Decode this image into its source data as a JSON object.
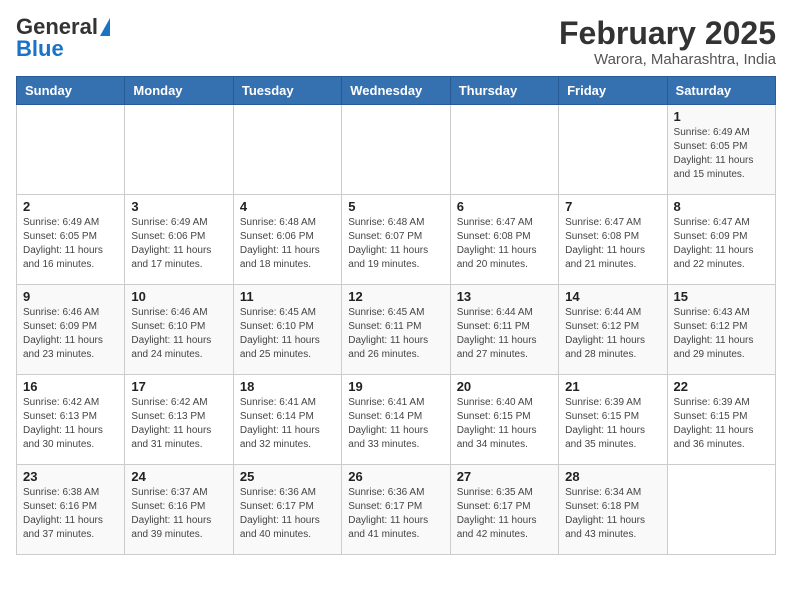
{
  "header": {
    "logo_general": "General",
    "logo_blue": "Blue",
    "month": "February 2025",
    "location": "Warora, Maharashtra, India"
  },
  "weekdays": [
    "Sunday",
    "Monday",
    "Tuesday",
    "Wednesday",
    "Thursday",
    "Friday",
    "Saturday"
  ],
  "weeks": [
    [
      {
        "day": "",
        "info": ""
      },
      {
        "day": "",
        "info": ""
      },
      {
        "day": "",
        "info": ""
      },
      {
        "day": "",
        "info": ""
      },
      {
        "day": "",
        "info": ""
      },
      {
        "day": "",
        "info": ""
      },
      {
        "day": "1",
        "info": "Sunrise: 6:49 AM\nSunset: 6:05 PM\nDaylight: 11 hours\nand 15 minutes."
      }
    ],
    [
      {
        "day": "2",
        "info": "Sunrise: 6:49 AM\nSunset: 6:05 PM\nDaylight: 11 hours\nand 16 minutes."
      },
      {
        "day": "3",
        "info": "Sunrise: 6:49 AM\nSunset: 6:06 PM\nDaylight: 11 hours\nand 17 minutes."
      },
      {
        "day": "4",
        "info": "Sunrise: 6:48 AM\nSunset: 6:06 PM\nDaylight: 11 hours\nand 18 minutes."
      },
      {
        "day": "5",
        "info": "Sunrise: 6:48 AM\nSunset: 6:07 PM\nDaylight: 11 hours\nand 19 minutes."
      },
      {
        "day": "6",
        "info": "Sunrise: 6:47 AM\nSunset: 6:08 PM\nDaylight: 11 hours\nand 20 minutes."
      },
      {
        "day": "7",
        "info": "Sunrise: 6:47 AM\nSunset: 6:08 PM\nDaylight: 11 hours\nand 21 minutes."
      },
      {
        "day": "8",
        "info": "Sunrise: 6:47 AM\nSunset: 6:09 PM\nDaylight: 11 hours\nand 22 minutes."
      }
    ],
    [
      {
        "day": "9",
        "info": "Sunrise: 6:46 AM\nSunset: 6:09 PM\nDaylight: 11 hours\nand 23 minutes."
      },
      {
        "day": "10",
        "info": "Sunrise: 6:46 AM\nSunset: 6:10 PM\nDaylight: 11 hours\nand 24 minutes."
      },
      {
        "day": "11",
        "info": "Sunrise: 6:45 AM\nSunset: 6:10 PM\nDaylight: 11 hours\nand 25 minutes."
      },
      {
        "day": "12",
        "info": "Sunrise: 6:45 AM\nSunset: 6:11 PM\nDaylight: 11 hours\nand 26 minutes."
      },
      {
        "day": "13",
        "info": "Sunrise: 6:44 AM\nSunset: 6:11 PM\nDaylight: 11 hours\nand 27 minutes."
      },
      {
        "day": "14",
        "info": "Sunrise: 6:44 AM\nSunset: 6:12 PM\nDaylight: 11 hours\nand 28 minutes."
      },
      {
        "day": "15",
        "info": "Sunrise: 6:43 AM\nSunset: 6:12 PM\nDaylight: 11 hours\nand 29 minutes."
      }
    ],
    [
      {
        "day": "16",
        "info": "Sunrise: 6:42 AM\nSunset: 6:13 PM\nDaylight: 11 hours\nand 30 minutes."
      },
      {
        "day": "17",
        "info": "Sunrise: 6:42 AM\nSunset: 6:13 PM\nDaylight: 11 hours\nand 31 minutes."
      },
      {
        "day": "18",
        "info": "Sunrise: 6:41 AM\nSunset: 6:14 PM\nDaylight: 11 hours\nand 32 minutes."
      },
      {
        "day": "19",
        "info": "Sunrise: 6:41 AM\nSunset: 6:14 PM\nDaylight: 11 hours\nand 33 minutes."
      },
      {
        "day": "20",
        "info": "Sunrise: 6:40 AM\nSunset: 6:15 PM\nDaylight: 11 hours\nand 34 minutes."
      },
      {
        "day": "21",
        "info": "Sunrise: 6:39 AM\nSunset: 6:15 PM\nDaylight: 11 hours\nand 35 minutes."
      },
      {
        "day": "22",
        "info": "Sunrise: 6:39 AM\nSunset: 6:15 PM\nDaylight: 11 hours\nand 36 minutes."
      }
    ],
    [
      {
        "day": "23",
        "info": "Sunrise: 6:38 AM\nSunset: 6:16 PM\nDaylight: 11 hours\nand 37 minutes."
      },
      {
        "day": "24",
        "info": "Sunrise: 6:37 AM\nSunset: 6:16 PM\nDaylight: 11 hours\nand 39 minutes."
      },
      {
        "day": "25",
        "info": "Sunrise: 6:36 AM\nSunset: 6:17 PM\nDaylight: 11 hours\nand 40 minutes."
      },
      {
        "day": "26",
        "info": "Sunrise: 6:36 AM\nSunset: 6:17 PM\nDaylight: 11 hours\nand 41 minutes."
      },
      {
        "day": "27",
        "info": "Sunrise: 6:35 AM\nSunset: 6:17 PM\nDaylight: 11 hours\nand 42 minutes."
      },
      {
        "day": "28",
        "info": "Sunrise: 6:34 AM\nSunset: 6:18 PM\nDaylight: 11 hours\nand 43 minutes."
      },
      {
        "day": "",
        "info": ""
      }
    ]
  ]
}
